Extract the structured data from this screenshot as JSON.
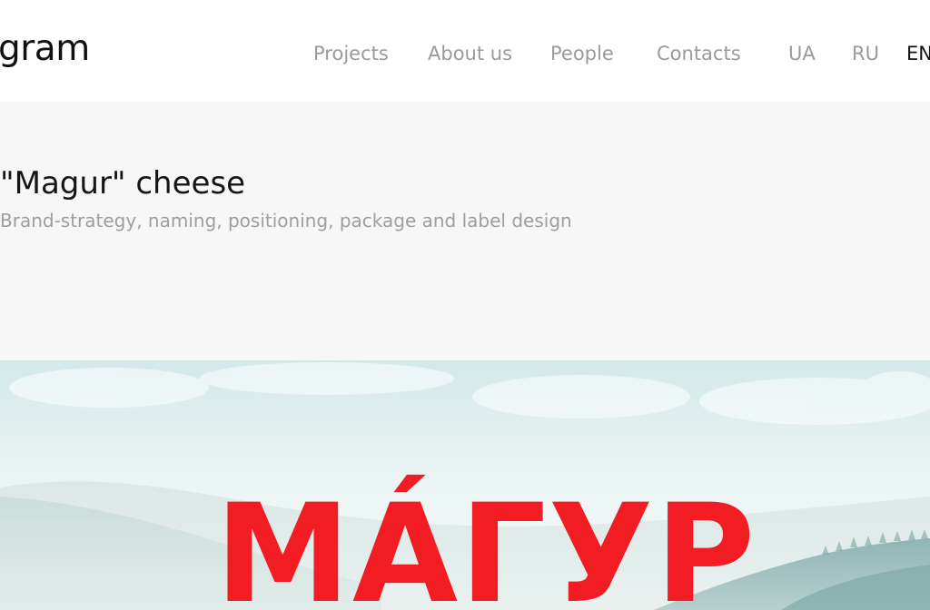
{
  "header": {
    "logo_text": "gram",
    "nav": {
      "projects": "Projects",
      "about": "About us",
      "people": "People",
      "contacts": "Contacts"
    },
    "languages": {
      "ua": "UA",
      "ru": "RU",
      "en": "EN"
    },
    "active_language": "EN"
  },
  "project": {
    "title": "\"Magur\" cheese",
    "subtitle": "Brand-strategy, naming, positioning, package and label design"
  },
  "hero": {
    "brand_wordmark": "МÁГУР",
    "wordmark_color": "#f21d23"
  }
}
